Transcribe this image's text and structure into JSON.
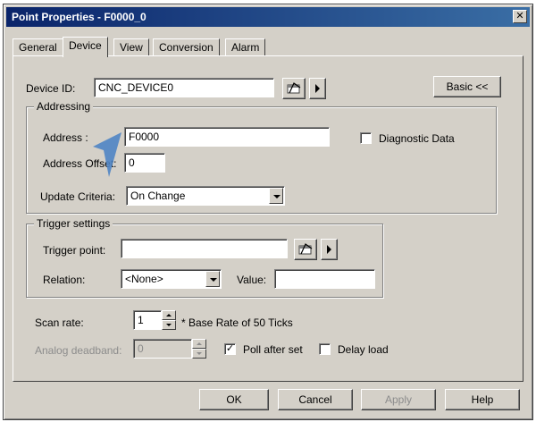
{
  "window": {
    "title": "Point Properties - F0000_0",
    "close_glyph": "✕"
  },
  "tabs": [
    {
      "label": "General",
      "active": false
    },
    {
      "label": "Device",
      "active": true
    },
    {
      "label": "View",
      "active": false
    },
    {
      "label": "Conversion",
      "active": false
    },
    {
      "label": "Alarm",
      "active": false
    }
  ],
  "device": {
    "label": "Device ID:",
    "value": "CNC_DEVICE0",
    "browse_icon": "browse-icon",
    "basic_label": "Basic <<"
  },
  "addressing": {
    "group_title": "Addressing",
    "address_label": "Address :",
    "address_value": "F0000",
    "address_offset_label": "Address Offset:",
    "address_offset_value": "0",
    "diagnostic_label": "Diagnostic Data",
    "diagnostic_checked": false,
    "update_label": "Update Criteria:",
    "update_value": "On Change"
  },
  "trigger": {
    "group_title": "Trigger settings",
    "point_label": "Trigger point:",
    "point_value": "",
    "relation_label": "Relation:",
    "relation_value": "<None>",
    "value_label": "Value:",
    "value_value": ""
  },
  "scan": {
    "label": "Scan rate:",
    "value": "1",
    "note": "* Base Rate of 50 Ticks"
  },
  "analog": {
    "label": "Analog deadband:",
    "value": "0",
    "poll_label": "Poll after set",
    "poll_checked": true,
    "poll_glyph": "✓",
    "delay_label": "Delay load",
    "delay_checked": false
  },
  "buttons": {
    "ok": "OK",
    "cancel": "Cancel",
    "apply": "Apply",
    "help": "Help"
  },
  "colors": {
    "title_start": "#0a246a",
    "title_end": "#3a6ea5",
    "face": "#d4d0c8",
    "cursor": "#4f84c4"
  }
}
